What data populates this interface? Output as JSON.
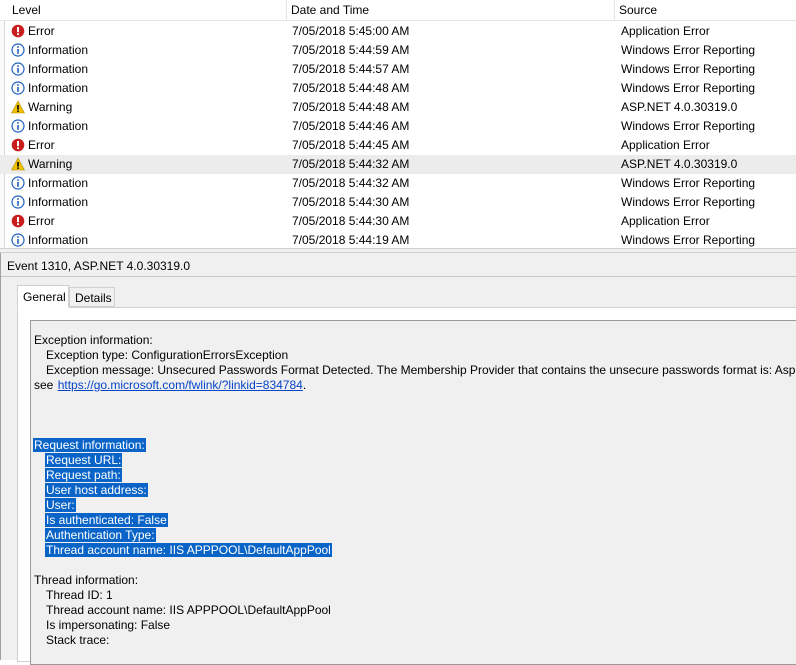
{
  "event_list": {
    "columns": [
      "Level",
      "Date and Time",
      "Source"
    ],
    "rows": [
      {
        "level": "Error",
        "icon": "error-icon",
        "datetime": "7/05/2018 5:45:00 AM",
        "source": "Application Error"
      },
      {
        "level": "Information",
        "icon": "info-icon",
        "datetime": "7/05/2018 5:44:59 AM",
        "source": "Windows Error Reporting"
      },
      {
        "level": "Information",
        "icon": "info-icon",
        "datetime": "7/05/2018 5:44:57 AM",
        "source": "Windows Error Reporting"
      },
      {
        "level": "Information",
        "icon": "info-icon",
        "datetime": "7/05/2018 5:44:48 AM",
        "source": "Windows Error Reporting"
      },
      {
        "level": "Warning",
        "icon": "warning-icon",
        "datetime": "7/05/2018 5:44:48 AM",
        "source": "ASP.NET 4.0.30319.0"
      },
      {
        "level": "Information",
        "icon": "info-icon",
        "datetime": "7/05/2018 5:44:46 AM",
        "source": "Windows Error Reporting"
      },
      {
        "level": "Error",
        "icon": "error-icon",
        "datetime": "7/05/2018 5:44:45 AM",
        "source": "Application Error"
      },
      {
        "level": "Warning",
        "icon": "warning-icon",
        "datetime": "7/05/2018 5:44:32 AM",
        "source": "ASP.NET 4.0.30319.0",
        "selected": true
      },
      {
        "level": "Information",
        "icon": "info-icon",
        "datetime": "7/05/2018 5:44:32 AM",
        "source": "Windows Error Reporting"
      },
      {
        "level": "Information",
        "icon": "info-icon",
        "datetime": "7/05/2018 5:44:30 AM",
        "source": "Windows Error Reporting"
      },
      {
        "level": "Error",
        "icon": "error-icon",
        "datetime": "7/05/2018 5:44:30 AM",
        "source": "Application Error"
      },
      {
        "level": "Information",
        "icon": "info-icon",
        "datetime": "7/05/2018 5:44:19 AM",
        "source": "Windows Error Reporting"
      }
    ]
  },
  "detail": {
    "title": "Event 1310, ASP.NET 4.0.30319.0",
    "tabs": [
      "General",
      "Details"
    ],
    "lines": [
      {
        "text": "Exception information:",
        "indent": 0
      },
      {
        "text": "Exception type: ConfigurationErrorsException",
        "indent": 1
      },
      {
        "text": "Exception message: Unsecured Passwords Format Detected. The Membership Provider that contains the unsecure passwords format is: AspNetSqlMembershipProvider. To resolve this issue,",
        "indent": 1
      },
      {
        "text": "see ",
        "indent": 0,
        "link": "https://go.microsoft.com/fwlink/?linkid=834784",
        "after": "."
      },
      {
        "text": "",
        "indent": 0
      },
      {
        "text": "",
        "indent": 0
      },
      {
        "text": "",
        "indent": 0
      },
      {
        "text": "Request information:",
        "indent": 0,
        "selected": true
      },
      {
        "text": "Request URL:",
        "indent": 1,
        "selected": true
      },
      {
        "text": "Request path:",
        "indent": 1,
        "selected": true
      },
      {
        "text": "User host address:",
        "indent": 1,
        "selected": true
      },
      {
        "text": "User:",
        "indent": 1,
        "selected": true
      },
      {
        "text": "Is authenticated: False",
        "indent": 1,
        "selected": true
      },
      {
        "text": "Authentication Type:",
        "indent": 1,
        "selected": true
      },
      {
        "text": "Thread account name: IIS APPPOOL\\DefaultAppPool",
        "indent": 1,
        "selected": true
      },
      {
        "text": "",
        "indent": 0
      },
      {
        "text": "Thread information:",
        "indent": 0
      },
      {
        "text": "Thread ID: 1",
        "indent": 1
      },
      {
        "text": "Thread account name: IIS APPPOOL\\DefaultAppPool",
        "indent": 1
      },
      {
        "text": "Is impersonating: False",
        "indent": 1
      },
      {
        "text": "Stack trace:",
        "indent": 1
      }
    ]
  },
  "colors": {
    "selection": "#0a64c8",
    "link": "#0645c8",
    "error": "#c81e1e",
    "info": "#1f5fbf",
    "warning": "#f2c200"
  }
}
